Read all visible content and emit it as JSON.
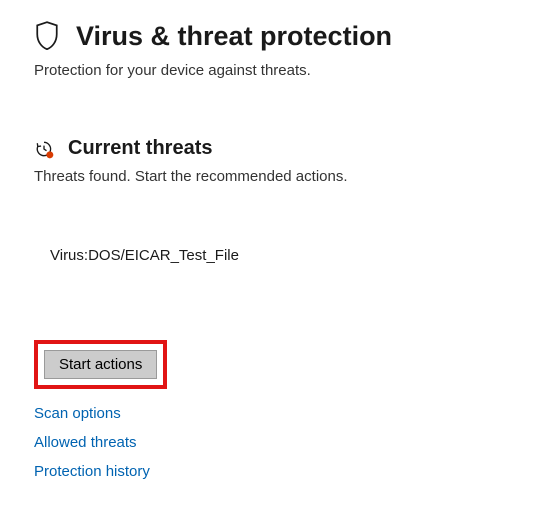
{
  "page": {
    "title": "Virus & threat protection",
    "subtitle": "Protection for your device against threats."
  },
  "current_threats": {
    "heading": "Current threats",
    "subtitle": "Threats found. Start the recommended actions.",
    "items": [
      {
        "name": "Virus:DOS/EICAR_Test_File"
      }
    ],
    "action_button": "Start actions"
  },
  "links": {
    "scan_options": "Scan options",
    "allowed_threats": "Allowed threats",
    "protection_history": "Protection history"
  }
}
